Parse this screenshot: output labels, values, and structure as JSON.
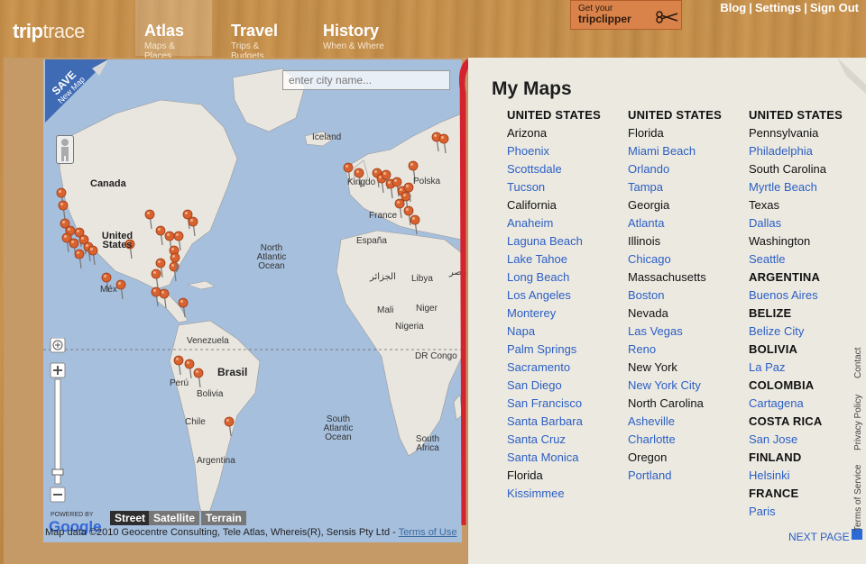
{
  "header": {
    "logo_bold": "trip",
    "logo_light": "trace",
    "tabs": [
      {
        "title": "Atlas",
        "subtitle": "Maps & Places"
      },
      {
        "title": "Travel",
        "subtitle": "Trips & Budgets"
      },
      {
        "title": "History",
        "subtitle": "When & Where"
      }
    ],
    "clipper_small": "Get your",
    "clipper_big": "tripclipper",
    "links": [
      "Blog",
      "Settings",
      "Sign Out"
    ]
  },
  "map": {
    "save_label": "SAVE",
    "save_sub": "New Map",
    "search_placeholder": "enter city name...",
    "labels": {
      "iceland": "Iceland",
      "canada": "Canada",
      "us": "United States",
      "north_atlantic": "North Atlantic Ocean",
      "kingdom": "Kingdo",
      "polska": "Polska",
      "france": "France",
      "espana": "España",
      "algeria": "الجزائر",
      "libya": "Libya",
      "mali": "Mali",
      "niger": "Niger",
      "nigeria": "Nigeria",
      "dr_congo": "DR Congo",
      "mexico": "Méx",
      "venezuela": "Venezuela",
      "peru": "Perú",
      "brasil": "Brasil",
      "bolivia": "Bolivia",
      "chile": "Chile",
      "argentina": "Argentina",
      "south_atlantic": "South Atlantic Ocean",
      "south_africa": "South Africa",
      "egypt": "مصر"
    },
    "map_types": [
      "Street",
      "Satellite",
      "Terrain"
    ],
    "powered": "POWERED BY",
    "google": "Google",
    "attribution": "Map data ©2010 Geocentre Consulting, Tele Atlas, Whereis(R), Sensis Pty Ltd -",
    "terms_link": "Terms of Use"
  },
  "panel": {
    "title": "My Maps",
    "columns": [
      [
        {
          "t": "UNITED STATES",
          "k": "country"
        },
        {
          "t": "Arizona",
          "k": "state"
        },
        {
          "t": "Phoenix",
          "k": "city"
        },
        {
          "t": "Scottsdale",
          "k": "city"
        },
        {
          "t": "Tucson",
          "k": "city"
        },
        {
          "t": "California",
          "k": "state"
        },
        {
          "t": "Anaheim",
          "k": "city"
        },
        {
          "t": "Laguna Beach",
          "k": "city"
        },
        {
          "t": "Lake Tahoe",
          "k": "city"
        },
        {
          "t": "Long Beach",
          "k": "city"
        },
        {
          "t": "Los Angeles",
          "k": "city"
        },
        {
          "t": "Monterey",
          "k": "city"
        },
        {
          "t": "Napa",
          "k": "city"
        },
        {
          "t": "Palm Springs",
          "k": "city"
        },
        {
          "t": "Sacramento",
          "k": "city"
        },
        {
          "t": "San Diego",
          "k": "city"
        },
        {
          "t": "San Francisco",
          "k": "city"
        },
        {
          "t": "Santa Barbara",
          "k": "city"
        },
        {
          "t": "Santa Cruz",
          "k": "city"
        },
        {
          "t": "Santa Monica",
          "k": "city"
        },
        {
          "t": "Florida",
          "k": "state"
        },
        {
          "t": "Kissimmee",
          "k": "city"
        }
      ],
      [
        {
          "t": "UNITED STATES",
          "k": "country"
        },
        {
          "t": "Florida",
          "k": "state"
        },
        {
          "t": "Miami Beach",
          "k": "city"
        },
        {
          "t": "Orlando",
          "k": "city"
        },
        {
          "t": "Tampa",
          "k": "city"
        },
        {
          "t": "Georgia",
          "k": "state"
        },
        {
          "t": "Atlanta",
          "k": "city"
        },
        {
          "t": "Illinois",
          "k": "state"
        },
        {
          "t": "Chicago",
          "k": "city"
        },
        {
          "t": "Massachusetts",
          "k": "state"
        },
        {
          "t": "Boston",
          "k": "city"
        },
        {
          "t": "Nevada",
          "k": "state"
        },
        {
          "t": "Las Vegas",
          "k": "city"
        },
        {
          "t": "Reno",
          "k": "city"
        },
        {
          "t": "New York",
          "k": "state"
        },
        {
          "t": "New York City",
          "k": "city"
        },
        {
          "t": "North Carolina",
          "k": "state"
        },
        {
          "t": "Asheville",
          "k": "city"
        },
        {
          "t": "Charlotte",
          "k": "city"
        },
        {
          "t": "Oregon",
          "k": "state"
        },
        {
          "t": "Portland",
          "k": "city"
        }
      ],
      [
        {
          "t": "UNITED STATES",
          "k": "country"
        },
        {
          "t": "Pennsylvania",
          "k": "state"
        },
        {
          "t": "Philadelphia",
          "k": "city"
        },
        {
          "t": "South Carolina",
          "k": "state"
        },
        {
          "t": "Myrtle Beach",
          "k": "city"
        },
        {
          "t": "Texas",
          "k": "state"
        },
        {
          "t": "Dallas",
          "k": "city"
        },
        {
          "t": "Washington",
          "k": "state"
        },
        {
          "t": "Seattle",
          "k": "city"
        },
        {
          "t": "ARGENTINA",
          "k": "country"
        },
        {
          "t": "Buenos Aires",
          "k": "city"
        },
        {
          "t": "BELIZE",
          "k": "country"
        },
        {
          "t": "Belize City",
          "k": "city"
        },
        {
          "t": "BOLIVIA",
          "k": "country"
        },
        {
          "t": "La Paz",
          "k": "city"
        },
        {
          "t": "COLOMBIA",
          "k": "country"
        },
        {
          "t": "Cartagena",
          "k": "city"
        },
        {
          "t": "COSTA RICA",
          "k": "country"
        },
        {
          "t": "San Jose",
          "k": "city"
        },
        {
          "t": "FINLAND",
          "k": "country"
        },
        {
          "t": "Helsinki",
          "k": "city"
        },
        {
          "t": "FRANCE",
          "k": "country"
        },
        {
          "t": "Paris",
          "k": "city"
        }
      ]
    ],
    "next_page": "NEXT PAGE",
    "side_links": [
      "Terms of Service",
      "Privacy Policy",
      "Contact"
    ]
  },
  "colors": {
    "link": "#2b5fc4",
    "ribbon": "#d3232e",
    "accent_orange": "#d9824a"
  }
}
